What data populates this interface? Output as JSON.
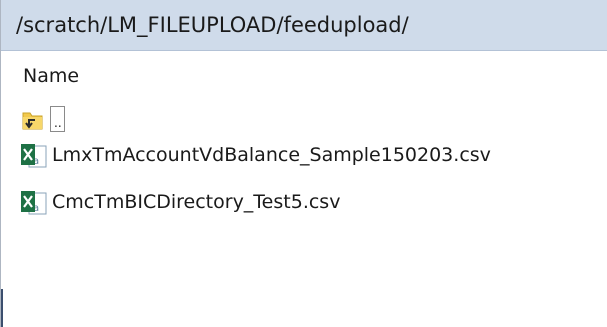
{
  "path_bar": {
    "path": "/scratch/LM_FILEUPLOAD/feedupload/"
  },
  "list": {
    "column_header": "Name",
    "parent_row": {
      "label": "..",
      "icon": "parent-folder-icon"
    },
    "files": [
      {
        "name": "LmxTmAccountVdBalance_Sample150203.csv",
        "icon": "excel-csv-icon"
      },
      {
        "name": "CmcTmBICDirectory_Test5.csv",
        "icon": "excel-csv-icon"
      }
    ]
  },
  "colors": {
    "path_bar_bg": "#cfdbea",
    "excel_green": "#1e7145",
    "folder_yellow": "#f2c94c"
  }
}
